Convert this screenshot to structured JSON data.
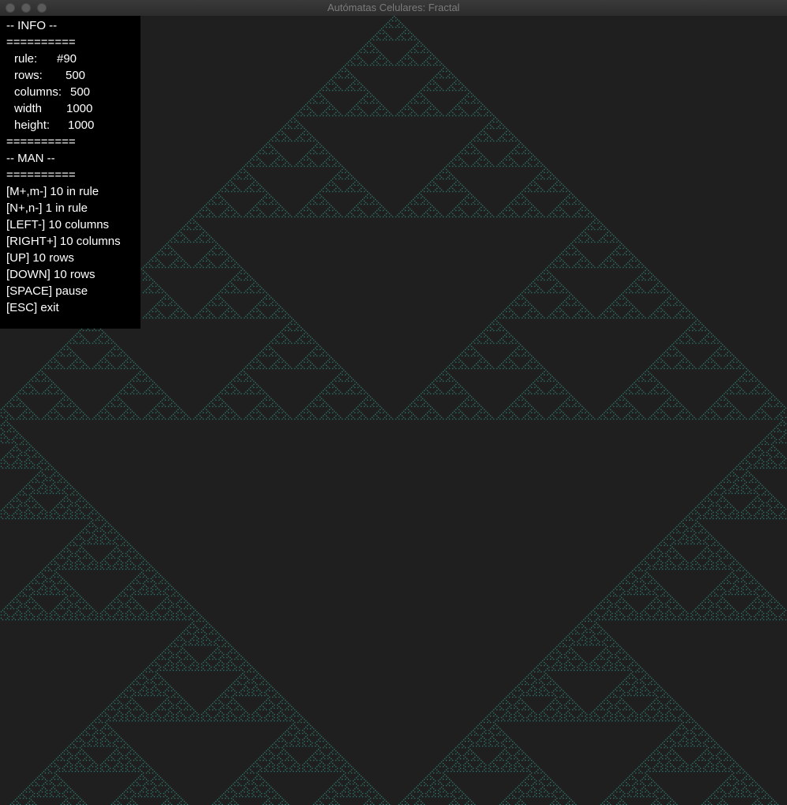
{
  "window": {
    "title": "Autómatas Celulares: Fractal"
  },
  "colors": {
    "background": "#1f1f1f",
    "cell": "#3bbfae",
    "overlay_bg": "#000000",
    "overlay_text": "#ffffff"
  },
  "info": {
    "header": "-- INFO --",
    "separator": "==========",
    "fields": [
      {
        "key": "rule:",
        "value": "#90"
      },
      {
        "key": "rows:",
        "value": "500"
      },
      {
        "key": "columns:",
        "value": "500"
      },
      {
        "key": "width",
        "value": "1000"
      },
      {
        "key": "height:",
        "value": "1000"
      }
    ]
  },
  "manual": {
    "header": "-- MAN --",
    "separator": "==========",
    "items": [
      "[M+,m-] 10 in rule",
      "[N+,n-] 1 in rule",
      "[LEFT-] 10 columns",
      "[RIGHT+] 10 columns",
      "[UP] 10 rows",
      "[DOWN] 10 rows",
      "[SPACE] pause",
      "[ESC] exit"
    ]
  },
  "automaton": {
    "rule": 90
  }
}
